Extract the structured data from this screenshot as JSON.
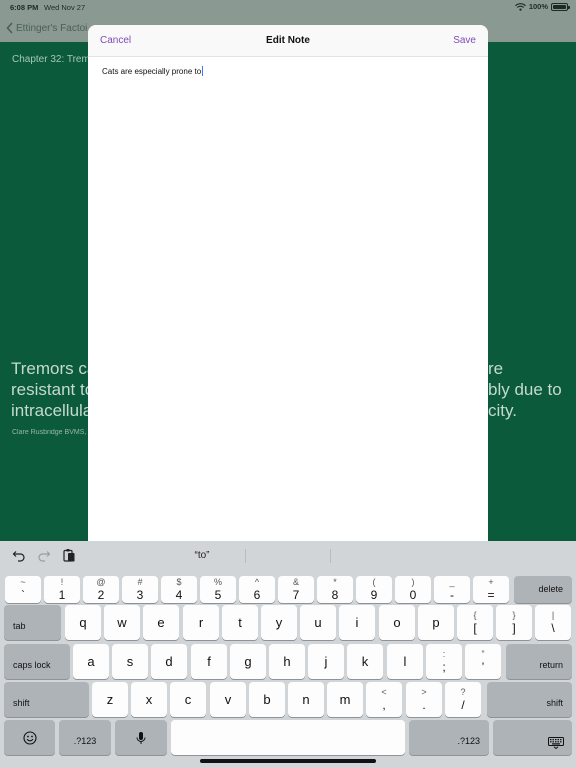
{
  "status_bar": {
    "time": "6:08 PM",
    "date": "Wed Nov 27",
    "battery": "100%"
  },
  "background": {
    "back_label": "Ettinger's Factoi",
    "chapter_label": "Chapter 32: Treme",
    "quote_left": [
      "Tremors ca",
      "resistant to",
      "intracellula"
    ],
    "quote_right": [
      "re",
      "bly due to",
      "city."
    ],
    "author": "Clare Rusbridge BVMS,"
  },
  "modal": {
    "cancel_label": "Cancel",
    "title": "Edit Note",
    "save_label": "Save",
    "note_text": "Cats are especially prone to"
  },
  "keyboard": {
    "suggestion": "“to”",
    "number_row": [
      {
        "top": "~",
        "bot": "`"
      },
      {
        "top": "!",
        "bot": "1"
      },
      {
        "top": "@",
        "bot": "2"
      },
      {
        "top": "#",
        "bot": "3"
      },
      {
        "top": "$",
        "bot": "4"
      },
      {
        "top": "%",
        "bot": "5"
      },
      {
        "top": "^",
        "bot": "6"
      },
      {
        "top": "&",
        "bot": "7"
      },
      {
        "top": "*",
        "bot": "8"
      },
      {
        "top": "(",
        "bot": "9"
      },
      {
        "top": ")",
        "bot": "0"
      },
      {
        "top": "_",
        "bot": "-"
      },
      {
        "top": "+",
        "bot": "="
      }
    ],
    "delete_label": "delete",
    "tab_label": "tab",
    "row_q": [
      "q",
      "w",
      "e",
      "r",
      "t",
      "y",
      "u",
      "i",
      "o",
      "p"
    ],
    "row_q_extra": [
      {
        "top": "{",
        "bot": "["
      },
      {
        "top": "}",
        "bot": "]"
      },
      {
        "top": "|",
        "bot": "\\"
      }
    ],
    "caps_label": "caps lock",
    "row_a": [
      "a",
      "s",
      "d",
      "f",
      "g",
      "h",
      "j",
      "k",
      "l"
    ],
    "row_a_extra": [
      {
        "top": ":",
        "bot": ";"
      },
      {
        "top": "”",
        "bot": "’"
      }
    ],
    "return_label": "return",
    "shift_label": "shift",
    "row_z": [
      "z",
      "x",
      "c",
      "v",
      "b",
      "n",
      "m"
    ],
    "row_z_extra": [
      {
        "top": "<",
        "bot": ","
      },
      {
        "top": ">",
        "bot": "."
      },
      {
        "top": "?",
        "bot": "/"
      }
    ],
    "numeric_label": ".?123"
  }
}
